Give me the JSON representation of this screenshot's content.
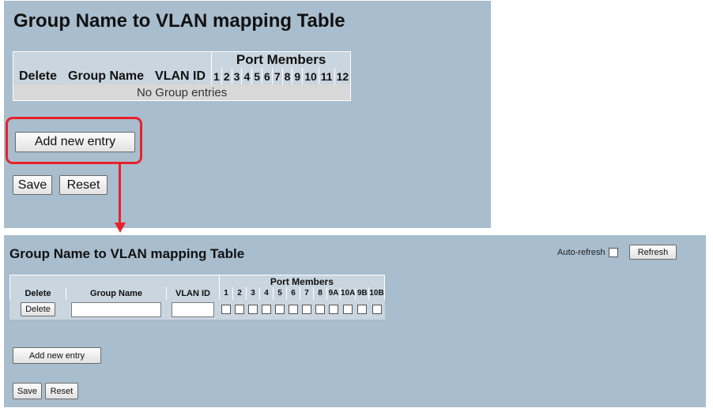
{
  "top": {
    "title": "Group Name to VLAN mapping Table",
    "port_members_label": "Port Members",
    "columns": {
      "delete": "Delete",
      "group_name": "Group Name",
      "vlan_id": "VLAN ID"
    },
    "ports": [
      "1",
      "2",
      "3",
      "4",
      "5",
      "6",
      "7",
      "8",
      "9",
      "10",
      "11",
      "12"
    ],
    "empty_message": "No Group entries",
    "add_button": "Add new entry",
    "save_button": "Save",
    "reset_button": "Reset"
  },
  "bottom": {
    "title": "Group Name to VLAN mapping Table",
    "auto_refresh_label": "Auto-refresh",
    "refresh_button": "Refresh",
    "port_members_label": "Port Members",
    "columns": {
      "delete": "Delete",
      "group_name": "Group Name",
      "vlan_id": "VLAN ID"
    },
    "ports": [
      "1",
      "2",
      "3",
      "4",
      "5",
      "6",
      "7",
      "8",
      "9A",
      "10A",
      "9B",
      "10B"
    ],
    "row": {
      "delete_button": "Delete",
      "group_name_value": "",
      "vlan_id_value": ""
    },
    "add_button": "Add new entry",
    "save_button": "Save",
    "reset_button": "Reset"
  },
  "annotation_color": "#e8202a",
  "panel_color": "#a8bdcd"
}
